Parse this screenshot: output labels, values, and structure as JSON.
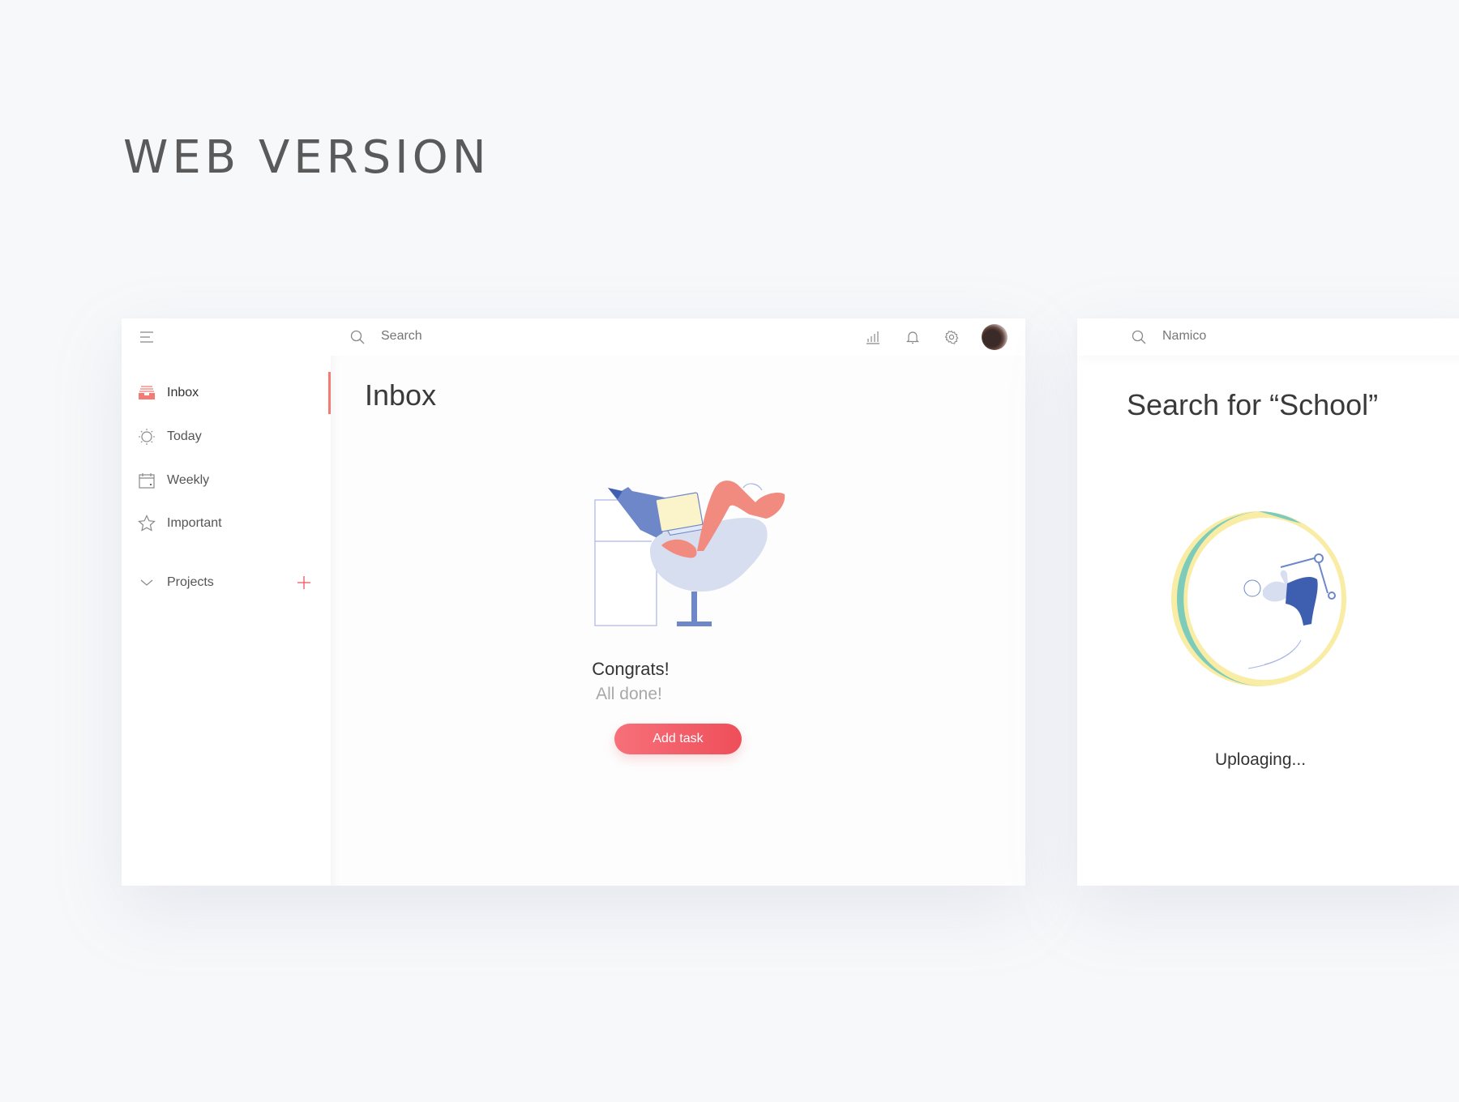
{
  "page_title": "WEB VERSION",
  "main_window": {
    "topbar": {
      "menu_icon": "hamburger-icon",
      "search_placeholder": "Search",
      "icons": [
        "bar-chart-icon",
        "bell-icon",
        "gear-icon",
        "avatar"
      ]
    },
    "sidebar": {
      "items": [
        {
          "label": "Inbox",
          "icon": "inbox-icon",
          "active": true
        },
        {
          "label": "Today",
          "icon": "sun-icon"
        },
        {
          "label": "Weekly",
          "icon": "calendar-icon"
        },
        {
          "label": "Important",
          "icon": "star-icon"
        }
      ],
      "projects": {
        "label": "Projects",
        "add_icon": "plus-icon"
      }
    },
    "content": {
      "title": "Inbox",
      "more_icon": "ellipsis-icon",
      "empty_title": "Congrats!",
      "empty_subtitle": "All done!",
      "add_task_label": "Add task"
    }
  },
  "search_window": {
    "search_value": "Namico",
    "title": "Search for “School”",
    "status": "Uploaging..."
  },
  "colors": {
    "accent": "#f47b74",
    "button": "#ee4f5a",
    "teal": "#7ccbbb",
    "yellow": "#f9eca4",
    "indigo": "#6d87c9"
  }
}
